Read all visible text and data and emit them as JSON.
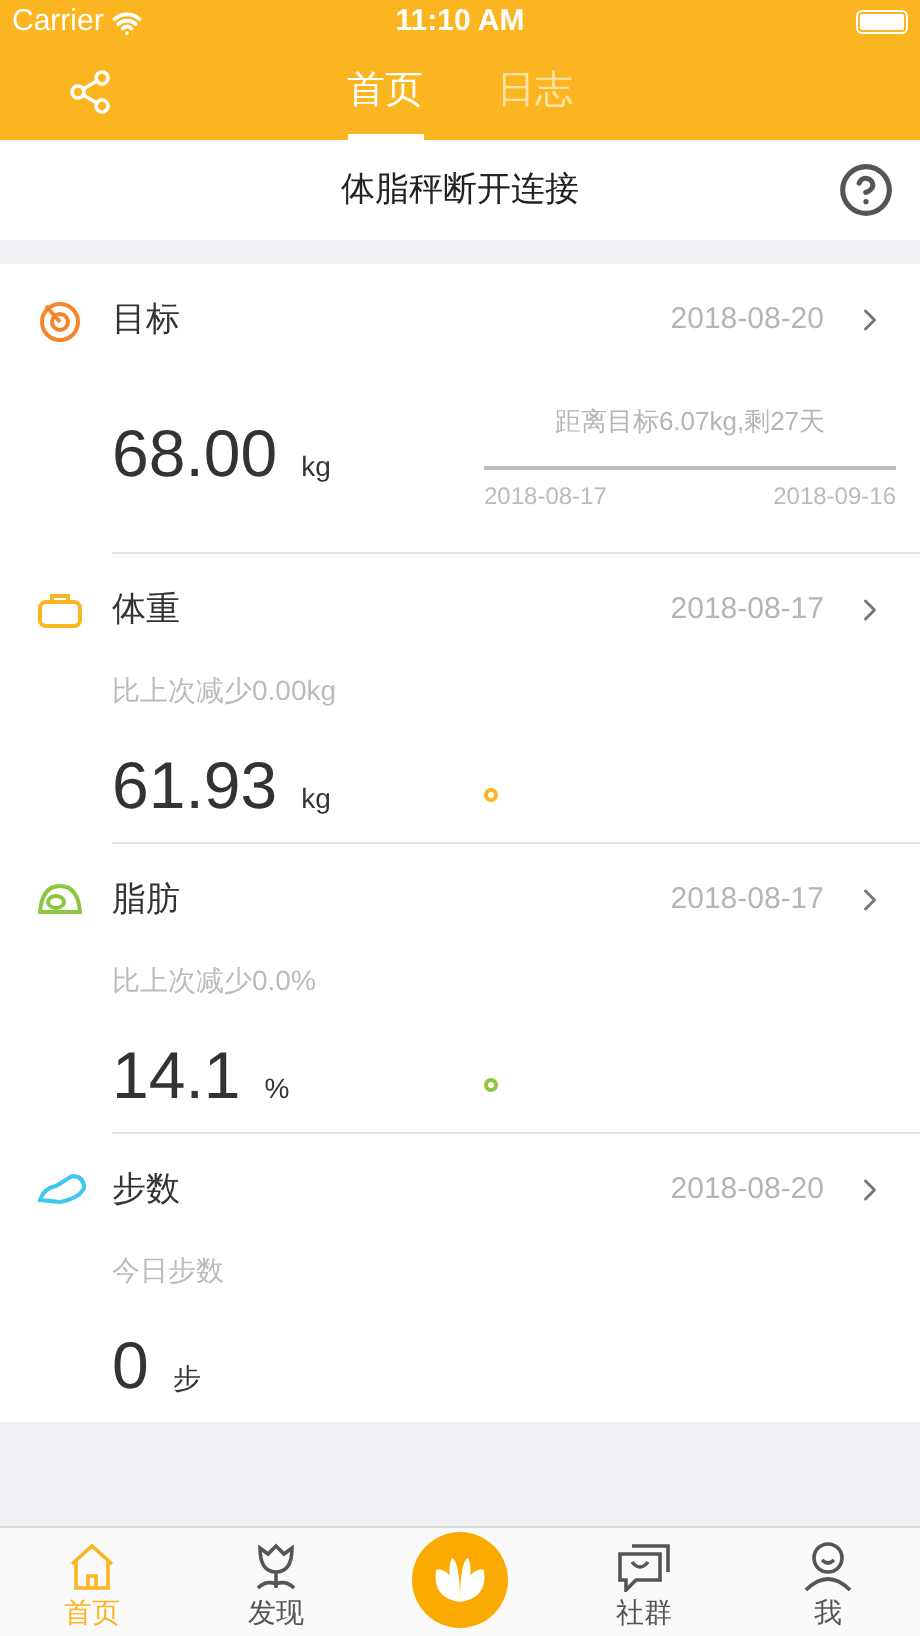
{
  "status_bar": {
    "carrier": "Carrier",
    "time": "11:10 AM"
  },
  "nav": {
    "tabs": [
      {
        "label": "首页",
        "selected": true
      },
      {
        "label": "日志",
        "selected": false
      }
    ]
  },
  "banner": {
    "text": "体脂秤断开连接"
  },
  "sections": [
    {
      "kind": "goal",
      "title": "目标",
      "date": "2018-08-20",
      "color": "#f7862b",
      "value": "68.00",
      "unit": "kg",
      "note": "距离目标6.07kg,剩27天",
      "start": "2018-08-17",
      "end": "2018-09-16"
    },
    {
      "kind": "weight",
      "title": "体重",
      "date": "2018-08-17",
      "color": "#fbb520",
      "subtitle": "比上次减少0.00kg",
      "value": "61.93",
      "unit": "kg"
    },
    {
      "kind": "fat",
      "title": "脂肪",
      "date": "2018-08-17",
      "color": "#8cc63f",
      "subtitle": "比上次减少0.0%",
      "value": "14.1",
      "unit": "%"
    },
    {
      "kind": "steps",
      "title": "步数",
      "date": "2018-08-20",
      "color": "#3ec5f0",
      "subtitle": "今日步数",
      "value": "0",
      "unit": "步"
    }
  ],
  "tab_bar": [
    {
      "kind": "home",
      "label": "首页",
      "selected": true
    },
    {
      "kind": "discover",
      "label": "发现",
      "selected": false
    },
    {
      "kind": "center"
    },
    {
      "kind": "community",
      "label": "社群",
      "selected": false
    },
    {
      "kind": "me",
      "label": "我",
      "selected": false
    }
  ]
}
